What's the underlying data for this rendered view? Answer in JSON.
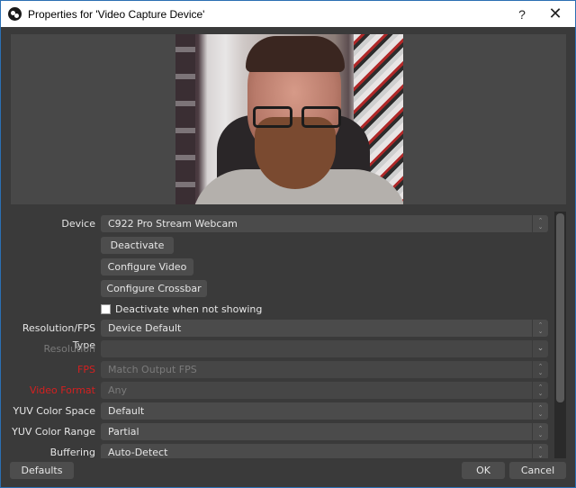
{
  "window": {
    "title": "Properties for 'Video Capture Device'",
    "app_icon": "obs-logo-icon",
    "help_label": "?",
    "close_label": "✕"
  },
  "preview": {
    "description": "Webcam live preview"
  },
  "properties": {
    "device": {
      "label": "Device",
      "value": "C922 Pro Stream Webcam",
      "control": "spinner"
    },
    "buttons": {
      "deactivate": "Deactivate",
      "configure_video": "Configure Video",
      "configure_crossbar": "Configure Crossbar"
    },
    "deactivate_when_not_showing": {
      "label": "Deactivate when not showing",
      "checked": false
    },
    "rows": [
      {
        "label": "Resolution/FPS Type",
        "value": "Device Default",
        "state": "normal",
        "control": "spinner"
      },
      {
        "label": "Resolution",
        "value": "",
        "state": "disabled",
        "control": "dropdown"
      },
      {
        "label": "FPS",
        "value": "Match Output FPS",
        "state": "warning",
        "control": "spinner"
      },
      {
        "label": "Video Format",
        "value": "Any",
        "state": "warning",
        "control": "spinner"
      },
      {
        "label": "YUV Color Space",
        "value": "Default",
        "state": "normal",
        "control": "spinner"
      },
      {
        "label": "YUV Color Range",
        "value": "Partial",
        "state": "normal",
        "control": "spinner"
      },
      {
        "label": "Buffering",
        "value": "Auto-Detect",
        "state": "normal",
        "control": "spinner"
      }
    ]
  },
  "footer": {
    "defaults_label": "Defaults",
    "ok_label": "OK",
    "cancel_label": "Cancel"
  },
  "colors": {
    "window_bg": "#3a3a3a",
    "field_bg": "#4b4b4b",
    "warning_label": "#d42020",
    "disabled_text": "#7a7a7a",
    "border_accent": "#2b6fb3"
  }
}
